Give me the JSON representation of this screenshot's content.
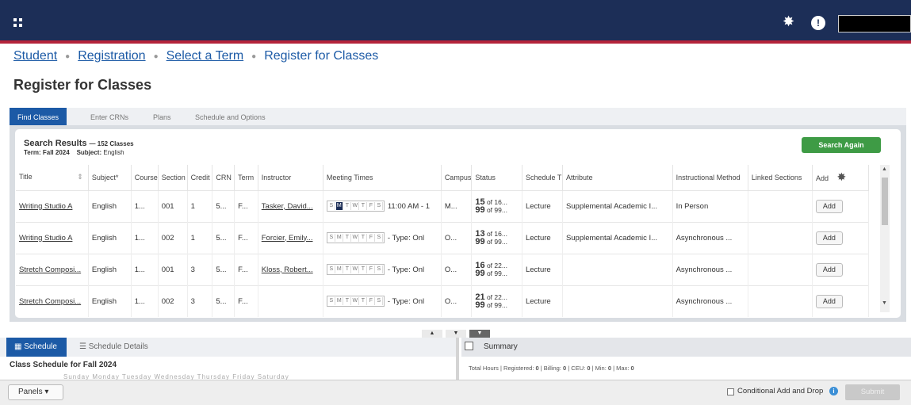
{
  "header": {
    "menu_icon": "grid-icon",
    "settings_icon": "gear-icon",
    "user_icon": "user-icon"
  },
  "breadcrumb": {
    "items": [
      "Student",
      "Registration",
      "Select a Term"
    ],
    "current": "Register for Classes"
  },
  "page_title": "Register for Classes",
  "tabs": [
    "Find Classes",
    "Enter CRNs",
    "Plans",
    "Schedule and Options"
  ],
  "results": {
    "title": "Search Results",
    "count": "— 152 Classes",
    "term_label": "Term:",
    "term_value": "Fall 2024",
    "subject_label": "Subject:",
    "subject_value": "English",
    "search_again": "Search Again",
    "columns": [
      "Title",
      "Subject*",
      "Course",
      "Section",
      "Credit",
      "CRN",
      "Term",
      "Instructor",
      "Meeting Times",
      "Campus",
      "Status",
      "Schedule T",
      "Attribute",
      "Instructional Method",
      "Linked Sections",
      "Add"
    ],
    "rows": [
      {
        "title": "Writing Studio A",
        "subject": "English",
        "course": "1...",
        "section": "001",
        "credit": "1",
        "crn": "5...",
        "term": "F...",
        "instructor": "Tasker, David...",
        "meeting_active": "M",
        "meeting_text": "11:00 AM - 1",
        "campus": "M...",
        "status_top_num": "15",
        "status_top_rest": "of 16...",
        "status_bot_num": "99",
        "status_bot_rest": "of 99...",
        "schedule": "Lecture",
        "attribute": "Supplemental Academic I...",
        "method": "In Person",
        "linked": "",
        "add": "Add"
      },
      {
        "title": "Writing Studio A",
        "subject": "English",
        "course": "1...",
        "section": "002",
        "credit": "1",
        "crn": "5...",
        "term": "F...",
        "instructor": "Forcier, Emily...",
        "meeting_active": "",
        "meeting_text": "- Type: Onl",
        "campus": "O...",
        "status_top_num": "13",
        "status_top_rest": "of 16...",
        "status_bot_num": "99",
        "status_bot_rest": "of 99...",
        "schedule": "Lecture",
        "attribute": "Supplemental Academic I...",
        "method": "Asynchronous ...",
        "linked": "",
        "add": "Add"
      },
      {
        "title": "Stretch Composi...",
        "subject": "English",
        "course": "1...",
        "section": "001",
        "credit": "3",
        "crn": "5...",
        "term": "F...",
        "instructor": "Kloss, Robert...",
        "meeting_active": "",
        "meeting_text": "- Type: Onl",
        "campus": "O...",
        "status_top_num": "16",
        "status_top_rest": "of 22...",
        "status_bot_num": "99",
        "status_bot_rest": "of 99...",
        "schedule": "Lecture",
        "attribute": "",
        "method": "Asynchronous ...",
        "linked": "",
        "add": "Add"
      },
      {
        "title": "Stretch Composi...",
        "subject": "English",
        "course": "1...",
        "section": "002",
        "credit": "3",
        "crn": "5...",
        "term": "F...",
        "instructor": "",
        "meeting_active": "",
        "meeting_text": "- Type: Onl",
        "campus": "O...",
        "status_top_num": "21",
        "status_top_rest": "of 22...",
        "status_bot_num": "99",
        "status_bot_rest": "of 99...",
        "schedule": "Lecture",
        "attribute": "",
        "method": "Asynchronous ...",
        "linked": "",
        "add": "Add"
      }
    ],
    "day_letters": [
      "S",
      "M",
      "T",
      "W",
      "T",
      "F",
      "S"
    ]
  },
  "bottom_left": {
    "tab_schedule": "Schedule",
    "tab_details": "Schedule Details",
    "calendar_title": "Class Schedule for Fall 2024",
    "weekdays": "Sunday    Monday    Tuesday    Wednesday    Thursday    Friday    Saturday"
  },
  "bottom_right": {
    "title": "Summary",
    "total_hours_label": "Total Hours | Registered:",
    "registered": "0",
    "billing_label": "| Billing:",
    "billing": "0",
    "ceu_label": "| CEU:",
    "ceu": "0",
    "min_label": "| Min:",
    "min": "0",
    "max_label": "| Max:",
    "max": "0"
  },
  "footer": {
    "panels": "Panels ▾",
    "conditional": "Conditional Add and Drop",
    "submit": "Submit"
  },
  "colors": {
    "topbar": "#1c2e57",
    "accent_red": "#b4243a",
    "tab_blue": "#1c5aa6",
    "search_green": "#3e9b45"
  }
}
